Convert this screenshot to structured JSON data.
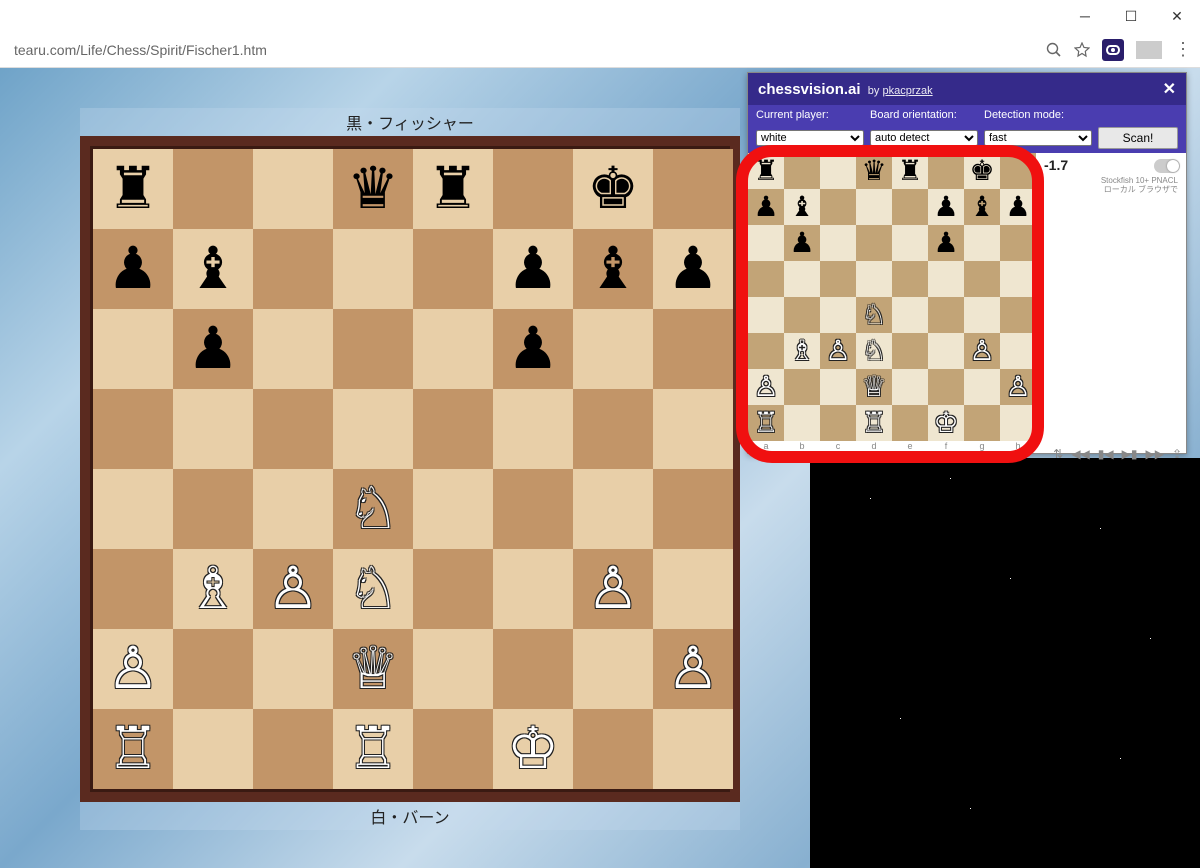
{
  "url": "tearu.com/Life/Chess/Spirit/Fischer1.htm",
  "caption_black": "黒・フィッシャー",
  "caption_white": "白・バーン",
  "ext": {
    "brand": "chessvision.ai",
    "by": "by",
    "author": "pkacprzak",
    "labels": {
      "current_player": "Current player:",
      "orientation": "Board orientation:",
      "detection": "Detection mode:"
    },
    "selects": {
      "player": "white",
      "orientation": "auto detect",
      "detection": "fast"
    },
    "scan": "Scan!",
    "eval": "-1.7",
    "engine_line1": "Stockfish 10+ PNACL",
    "engine_line2": "ローカル ブラウザで"
  },
  "board_fen_rows": [
    "r..qr.k.",
    "pb...pbp",
    ".p...p..",
    "........",
    "...N....",
    ".BPN..P.",
    "P..Q...P",
    "R..R.K.."
  ],
  "mini_fen_rows": [
    "r..qr.k.",
    "pb...pbp",
    ".p...p..",
    "........",
    "...N....",
    ".BPN..P.",
    "P..Q...P",
    "R..R.K.."
  ],
  "files": [
    "a",
    "b",
    "c",
    "d",
    "e",
    "f",
    "g",
    "h"
  ]
}
